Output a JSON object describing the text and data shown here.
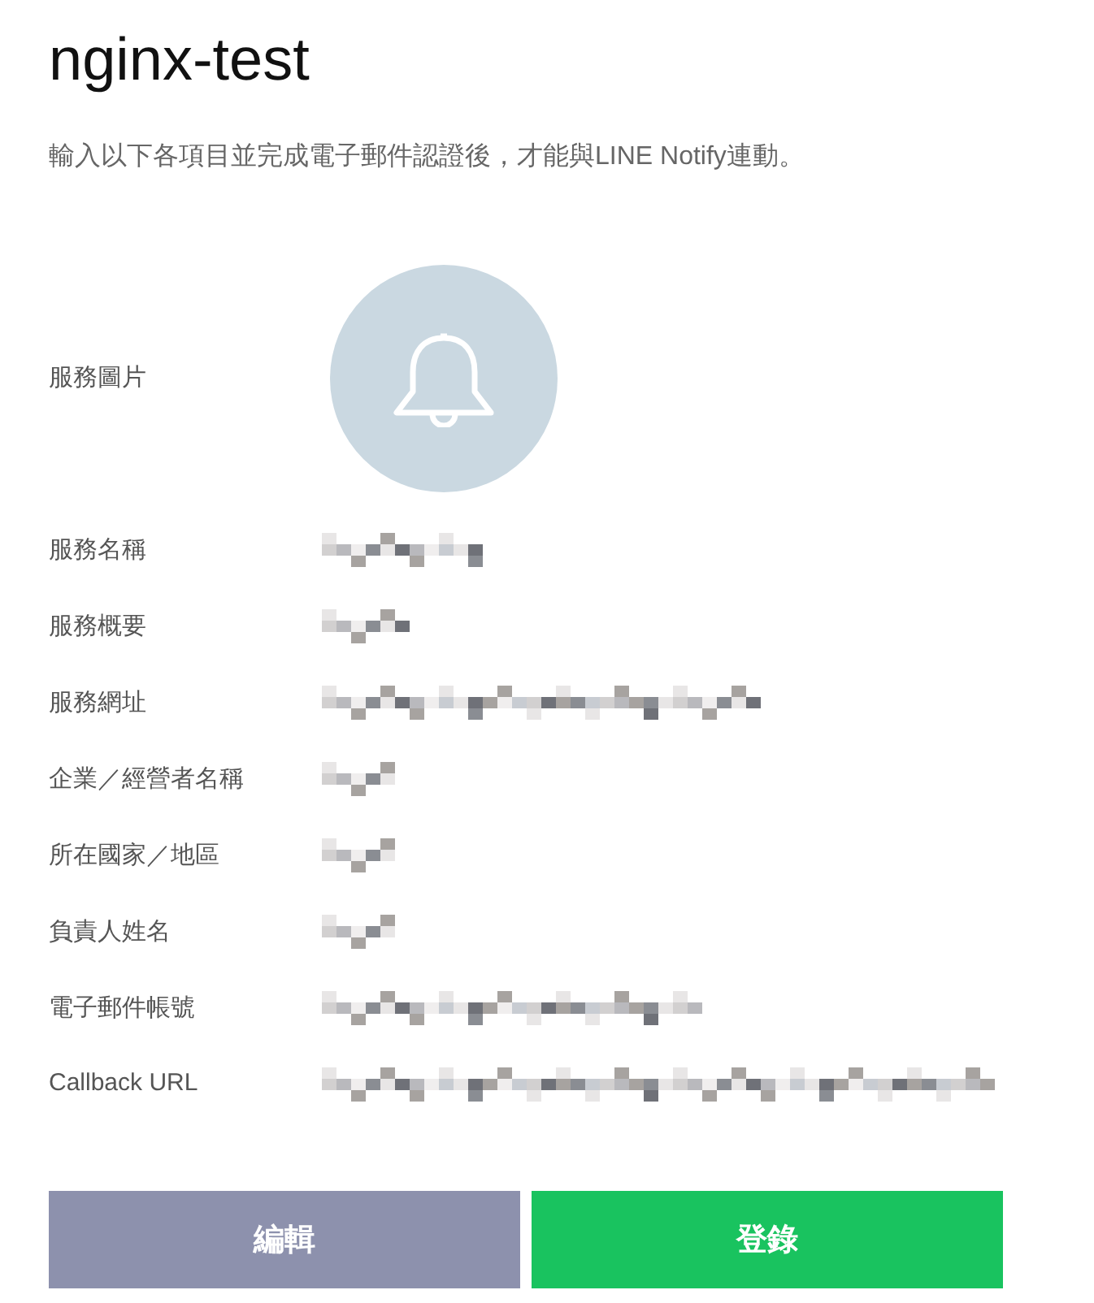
{
  "title": "nginx-test",
  "description": "輸入以下各項目並完成電子郵件認證後，才能與LINE Notify連動。",
  "service_image": {
    "label": "服務圖片"
  },
  "fields": [
    {
      "label": "服務名稱",
      "redacted": true
    },
    {
      "label": "服務概要",
      "redacted": true
    },
    {
      "label": "服務網址",
      "redacted": true
    },
    {
      "label": "企業／經營者名稱",
      "redacted": true
    },
    {
      "label": "所在國家／地區",
      "redacted": true
    },
    {
      "label": "負責人姓名",
      "redacted": true
    },
    {
      "label": "電子郵件帳號",
      "redacted": true
    },
    {
      "label": "Callback URL",
      "redacted": true
    }
  ],
  "buttons": [
    {
      "label": "編輯",
      "kind": "secondary"
    },
    {
      "label": "登錄",
      "kind": "primary"
    }
  ]
}
